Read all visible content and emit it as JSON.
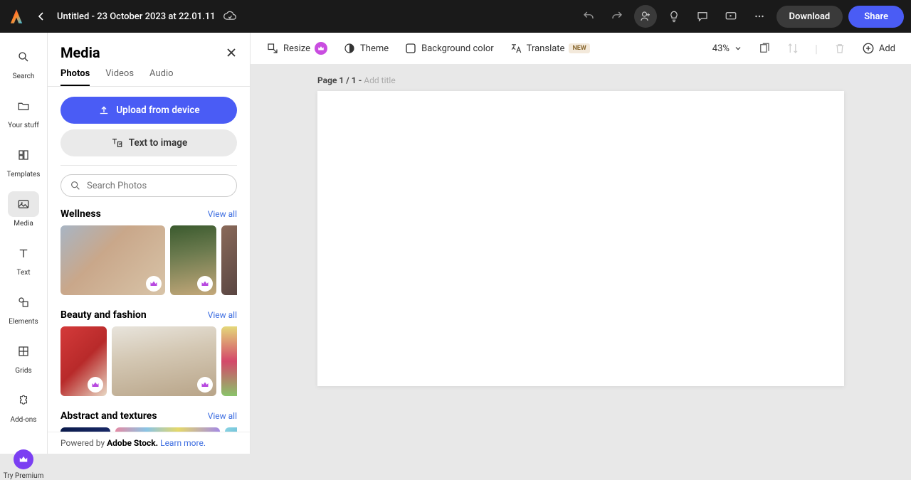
{
  "header": {
    "doc_title": "Untitled - 23 October 2023 at 22.01.11",
    "download": "Download",
    "share": "Share"
  },
  "rail": {
    "search": "Search",
    "your_stuff": "Your stuff",
    "templates": "Templates",
    "media": "Media",
    "text": "Text",
    "elements": "Elements",
    "grids": "Grids",
    "addons": "Add-ons",
    "premium": "Try Premium"
  },
  "panel": {
    "title": "Media",
    "tabs": {
      "photos": "Photos",
      "videos": "Videos",
      "audio": "Audio"
    },
    "upload": "Upload from device",
    "text_to_image": "Text to image",
    "search_placeholder": "Search Photos",
    "view_all": "View all",
    "categories": {
      "wellness": "Wellness",
      "beauty": "Beauty and fashion",
      "abstract": "Abstract and textures"
    },
    "footer_powered": "Powered by ",
    "footer_stock": "Adobe Stock.",
    "footer_learn": "Learn more."
  },
  "toolbar": {
    "resize": "Resize",
    "theme": "Theme",
    "bg": "Background color",
    "translate": "Translate",
    "new": "NEW",
    "zoom": "43%",
    "add": "Add"
  },
  "canvas": {
    "page_label": "Page 1 / 1 - ",
    "add_title": "Add title"
  },
  "colors": {
    "thumbs": {
      "wellness1": "linear-gradient(135deg,#a8b5c4 0%,#c9a78a 40%,#d8c4a8 100%)",
      "wellness2": "linear-gradient(170deg,#3a5a2e 0%,#6b7a4e 40%,#c4a87a 100%)",
      "wellness3": "linear-gradient(135deg,#8a6a5a 0%,#4a3a3a 100%)",
      "beauty1": "linear-gradient(135deg,#d43a3a 0%,#b82a2a 50%,#e8d8c4 100%)",
      "beauty2": "linear-gradient(170deg,#e8e4dc 0%,#d4c8b4 40%,#b8a488 100%)",
      "beauty3": "linear-gradient(180deg,#e4d87a 0%,#d4486a 50%,#8ac46a 100%)",
      "abstract1": "linear-gradient(135deg,#0a1a4a 0%,#1a2a6a 100%)",
      "abstract2": "linear-gradient(90deg,#e48aa4 0%,#8ac4e4 30%,#e4d86a 60%,#a48ae4 100%)",
      "abstract3": "linear-gradient(135deg,#8ad4e4 0%,#4aa4c4 100%)"
    }
  }
}
